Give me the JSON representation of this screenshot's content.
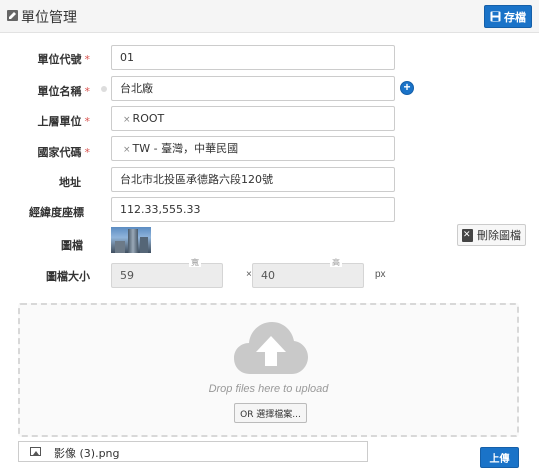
{
  "header": {
    "title": "單位管理",
    "title_icon": "edit-icon",
    "save_label": "存檔",
    "save_icon": "floppy-disk-icon"
  },
  "form": {
    "unit_code": {
      "label": "單位代號",
      "required_mark": "*",
      "value": "01"
    },
    "unit_name": {
      "label": "單位名稱",
      "required_mark": "*",
      "value": "台北廠",
      "add_icon": "plus-circle-icon"
    },
    "parent_unit": {
      "label": "上層單位",
      "required_mark": "*",
      "tag_remove": "×",
      "value": "ROOT"
    },
    "country_code": {
      "label": "國家代碼",
      "required_mark": "*",
      "tag_remove": "×",
      "value": "TW - 臺灣，中華民國"
    },
    "address": {
      "label": "地址",
      "value": "台北市北投區承德路六段120號"
    },
    "coordinates": {
      "label": "經緯度座標",
      "value": "112.33,555.33"
    },
    "image": {
      "label": "圖檔",
      "delete_label": "刪除圖檔",
      "delete_icon": "delete-file-icon"
    },
    "image_size": {
      "label": "圖檔大小",
      "width_caption": "寬",
      "width_value": "59",
      "times": "×",
      "height_caption": "高",
      "height_value": "40",
      "unit": "px"
    }
  },
  "dropzone": {
    "icon": "cloud-upload-icon",
    "text": "Drop files here to upload",
    "choose_label": "OR 選擇檔案..."
  },
  "file": {
    "icon": "image-file-icon",
    "name": "影像 (3).png"
  },
  "upload_label": "上傳",
  "colors": {
    "primary": "#1a73c8",
    "required": "#d9534f"
  }
}
